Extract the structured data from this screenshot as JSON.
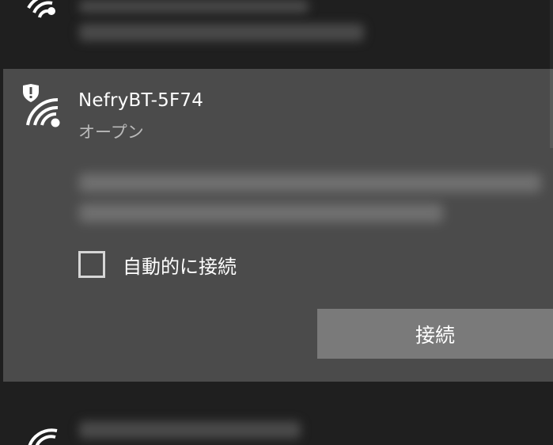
{
  "network_list": {
    "selected_network": {
      "ssid": "NefryBT-5F74",
      "security_status": "オープン",
      "auto_connect_label": "自動的に接続",
      "auto_connect_checked": false,
      "connect_button_label": "接続",
      "icon": "wifi-shield-warning-icon"
    },
    "other_network_icon": "wifi-icon"
  },
  "colors": {
    "background": "#1f1f1f",
    "card_background": "#4b4b4b",
    "button_background": "#7a7a7a",
    "secondary_text": "#b9b9b9"
  }
}
